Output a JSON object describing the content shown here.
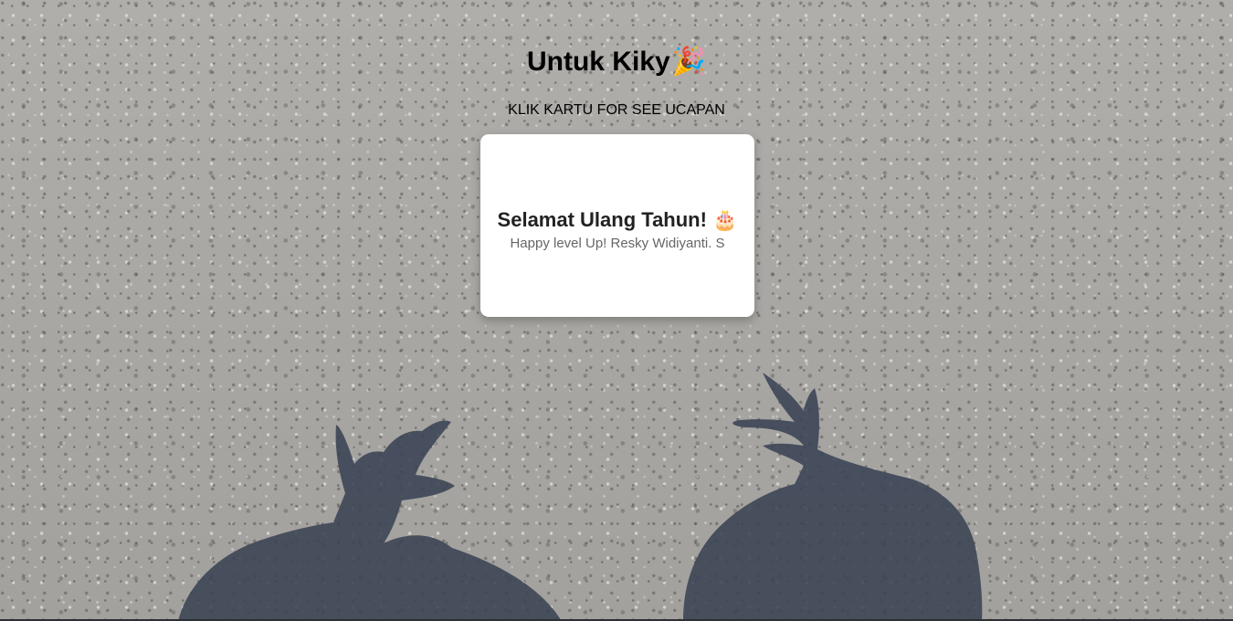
{
  "header": {
    "title": "Untuk Kiky",
    "title_emoji": "🎉",
    "instruction": "KLIK KARTU FOR SEE UCAPAN"
  },
  "card": {
    "title": "Selamat Ulang Tahun! 🎂",
    "message": "Happy level Up! Resky Widiyanti. S"
  },
  "colors": {
    "background_pavement": "#a8a6a2",
    "shadow": "#3a4354",
    "card_background": "#ffffff",
    "card_title": "#222222",
    "card_message": "#666666"
  }
}
